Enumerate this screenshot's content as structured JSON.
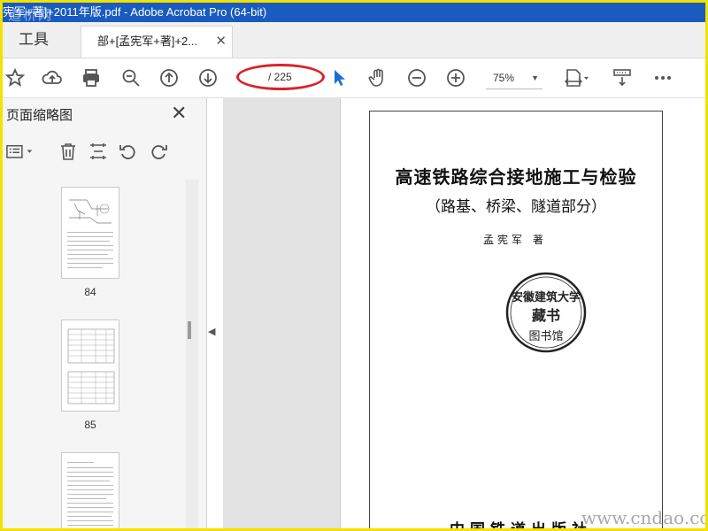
{
  "window": {
    "title": "宪军+著]+2011年版.pdf - Adobe Acrobat Pro (64-bit)",
    "watermark_top": "道桥网"
  },
  "tabs": {
    "tools_label": "工具",
    "doc_label": "部+[孟宪军+著]+2...",
    "close": "✕"
  },
  "toolbar": {
    "page_input": "",
    "page_total": "/ 225",
    "zoom": "75%",
    "zoom_caret": "▼"
  },
  "sidepanel": {
    "title": "页面缩略图",
    "close": "✕",
    "thumbnails": [
      {
        "label": "84"
      },
      {
        "label": "85"
      },
      {
        "label": ""
      }
    ]
  },
  "collapse_arrow": "◀",
  "document": {
    "title": "高速铁路综合接地施工与检验",
    "subtitle": "（路基、桥梁、隧道部分）",
    "author": "孟宪军  著",
    "stamp_text": "安徽建筑大学图书馆",
    "publisher": "中国铁道出版社"
  },
  "watermark_br": "www.cndao.com",
  "colors": {
    "titlebar": "#1a5bbf",
    "frame": "#f3e100",
    "annotation": "#d8232a",
    "cursor": "#1a6fd6"
  }
}
